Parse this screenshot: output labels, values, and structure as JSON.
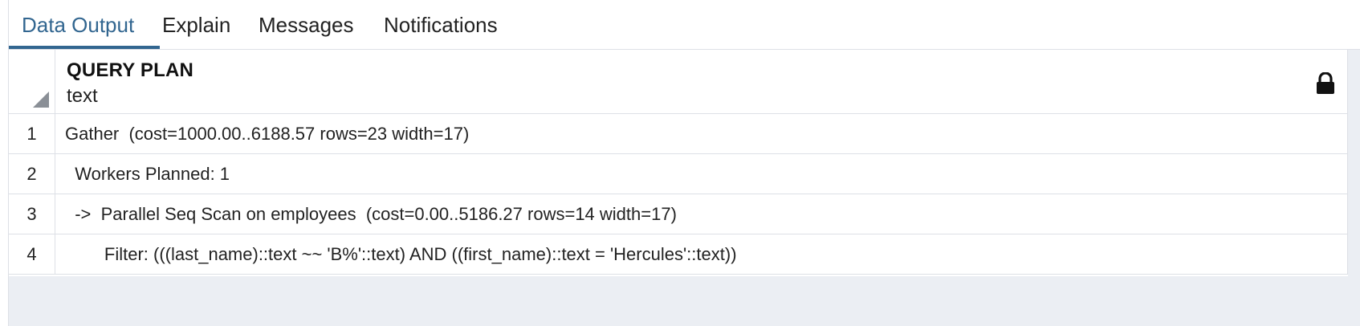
{
  "tabs": [
    {
      "label": "Data Output",
      "active": true
    },
    {
      "label": "Explain",
      "active": false
    },
    {
      "label": "Messages",
      "active": false
    },
    {
      "label": "Notifications",
      "active": false
    }
  ],
  "grid": {
    "column": {
      "name": "QUERY PLAN",
      "type": "text",
      "icon": "lock-icon"
    },
    "rows": [
      {
        "num": "1",
        "value": "Gather  (cost=1000.00..6188.57 rows=23 width=17)"
      },
      {
        "num": "2",
        "value": "  Workers Planned: 1"
      },
      {
        "num": "3",
        "value": "  ->  Parallel Seq Scan on employees  (cost=0.00..5186.27 rows=14 width=17)"
      },
      {
        "num": "4",
        "value": "        Filter: (((last_name)::text ~~ 'B%'::text) AND ((first_name)::text = 'Hercules'::text))"
      }
    ]
  },
  "colors": {
    "accent": "#326690",
    "background": "#ebeef3",
    "grid_line": "#dde0e6"
  }
}
